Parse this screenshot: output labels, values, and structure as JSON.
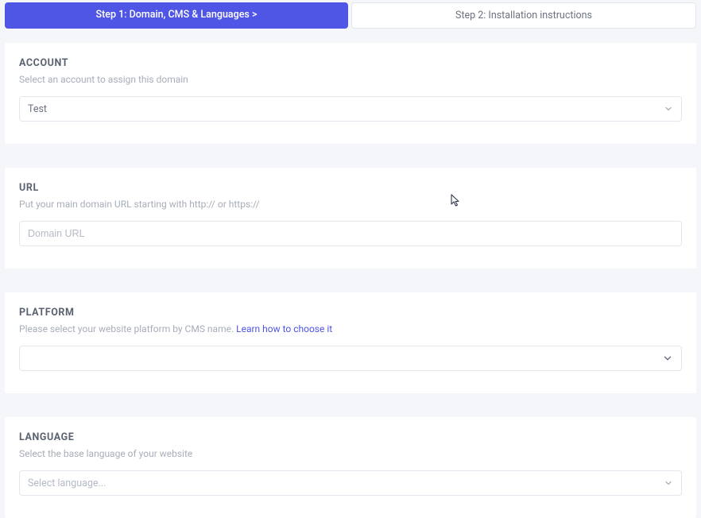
{
  "tabs": {
    "step1": "Step 1: Domain, CMS & Languages  >",
    "step2": "Step 2: Installation instructions"
  },
  "account": {
    "title": "ACCOUNT",
    "desc": "Select an account to assign this domain",
    "value": "Test"
  },
  "url": {
    "title": "URL",
    "desc": "Put your main domain URL starting with http:// or https://",
    "placeholder": "Domain URL"
  },
  "platform": {
    "title": "PLATFORM",
    "desc_prefix": "Please select your website platform by CMS name.  ",
    "link_text": "Learn how to choose it",
    "value": ""
  },
  "language": {
    "title": "LANGUAGE",
    "desc": "Select the base language of your website",
    "value": "Select language..."
  }
}
